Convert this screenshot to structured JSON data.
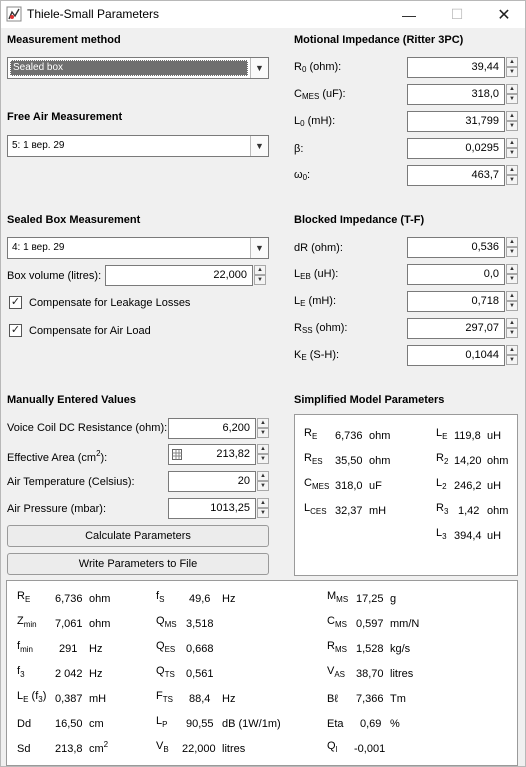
{
  "window": {
    "title": "Thiele-Small Parameters",
    "min_glyph": "—",
    "max_glyph": "☐",
    "close_glyph": "✕"
  },
  "measurement_method": {
    "heading": "Measurement method",
    "selected": "Sealed box"
  },
  "free_air": {
    "heading": "Free Air Measurement",
    "selected": "5: 1 вер. 29"
  },
  "sealed_box": {
    "heading": "Sealed Box Measurement",
    "selected": "4: 1 вер. 29",
    "box_volume_label": "Box volume (litres):",
    "box_volume_value": "22,000",
    "compensate_leakage_label": "Compensate for Leakage Losses",
    "compensate_leakage_checked": true,
    "compensate_air_label": "Compensate for Air Load",
    "compensate_air_checked": true,
    "check_glyph": "✓"
  },
  "manual": {
    "heading": "Manually Entered Values",
    "vc_label": "Voice Coil DC Resistance (ohm):",
    "vc_value": "6,200",
    "area_label_pre": "Effective Area (cm",
    "area_label_sup": "2",
    "area_label_post": "):",
    "area_value": "213,82",
    "temp_label": "Air Temperature (Celsius):",
    "temp_value": "20",
    "pressure_label": "Air Pressure (mbar):",
    "pressure_value": "1013,25",
    "calc_button": "Calculate Parameters",
    "write_button": "Write Parameters to File"
  },
  "motional": {
    "heading": "Motional Impedance (Ritter 3PC)",
    "r0": {
      "main": "R",
      "sub": "0",
      "unit": " (ohm):",
      "value": "39,44"
    },
    "cmes": {
      "main": "C",
      "sub": "MES",
      "unit": " (uF):",
      "value": "318,0"
    },
    "l0": {
      "main": "L",
      "sub": "0",
      "unit": " (mH):",
      "value": "31,799"
    },
    "beta": {
      "main": "β:",
      "value": "0,0295"
    },
    "omega": {
      "main": "ω",
      "sub": "0",
      "unit": ":",
      "value": "463,7"
    }
  },
  "blocked": {
    "heading": "Blocked Impedance (T-F)",
    "dr": {
      "main": "dR (ohm):",
      "value": "0,536"
    },
    "leb": {
      "main": "L",
      "sub": "EB",
      "unit": " (uH):",
      "value": "0,0"
    },
    "le": {
      "main": "L",
      "sub": "E",
      "unit": " (mH):",
      "value": "0,718"
    },
    "rss": {
      "main": "R",
      "sub": "SS",
      "unit": " (ohm):",
      "value": "297,07"
    },
    "ke": {
      "main": "K",
      "sub": "E",
      "unit": " (S-H):",
      "value": "0,1044"
    }
  },
  "simplified": {
    "heading": "Simplified Model Parameters",
    "re": {
      "main": "R",
      "sub": "E",
      "value": "6,736",
      "unit": "ohm"
    },
    "res": {
      "main": "R",
      "sub": "ES",
      "value": "35,50",
      "unit": "ohm"
    },
    "cmes": {
      "main": "C",
      "sub": "MES",
      "value": "318,0",
      "unit": "uF"
    },
    "lces": {
      "main": "L",
      "sub": "CES",
      "value": "32,37",
      "unit": "mH"
    },
    "le": {
      "main": "L",
      "sub": "E",
      "value": "119,8",
      "unit": "uH"
    },
    "r2": {
      "main": "R",
      "sub": "2",
      "value": "14,20",
      "unit": "ohm"
    },
    "l2": {
      "main": "L",
      "sub": "2",
      "value": "246,2",
      "unit": "uH"
    },
    "r3": {
      "main": "R",
      "sub": "3",
      "value": "1,42",
      "unit": "ohm"
    },
    "l3": {
      "main": "L",
      "sub": "3",
      "value": "394,4",
      "unit": "uH"
    }
  },
  "results": {
    "re": {
      "main": "R",
      "sub": "E",
      "value": "6,736",
      "unit": "ohm"
    },
    "zmin": {
      "main": "Z",
      "sub": "min",
      "value": "7,061",
      "unit": "ohm"
    },
    "fmin": {
      "main": "f",
      "sub": "min",
      "value": "291",
      "unit": "Hz"
    },
    "f3": {
      "main": "f",
      "sub": "3",
      "value": "2 042",
      "unit": "Hz"
    },
    "le_f3": {
      "main": "L",
      "sub": "E",
      "post": " (f",
      "sub2": "3",
      "post2": ")",
      "value": "0,387",
      "unit": "mH"
    },
    "dd": {
      "main": "Dd",
      "value": "16,50",
      "unit": "cm"
    },
    "sd": {
      "main": "Sd",
      "value": "213,8",
      "unit": "cm",
      "unit_sup": "2"
    },
    "fs": {
      "main": "f",
      "sub": "S",
      "value": "49,6",
      "unit": "Hz"
    },
    "qms": {
      "main": "Q",
      "sub": "MS",
      "value": "3,518",
      "unit": ""
    },
    "qes": {
      "main": "Q",
      "sub": "ES",
      "value": "0,668",
      "unit": ""
    },
    "qts": {
      "main": "Q",
      "sub": "TS",
      "value": "0,561",
      "unit": ""
    },
    "fts": {
      "main": "F",
      "sub": "TS",
      "value": "88,4",
      "unit": "Hz"
    },
    "lp": {
      "main": "L",
      "sub": "P",
      "value": "90,55",
      "unit": "dB (1W/1m)"
    },
    "vb": {
      "main": "V",
      "sub": "B",
      "value": "22,000",
      "unit": "litres"
    },
    "mms": {
      "main": "M",
      "sub": "MS",
      "value": "17,25",
      "unit": "g"
    },
    "cms": {
      "main": "C",
      "sub": "MS",
      "value": "0,597",
      "unit": "mm/N"
    },
    "rms": {
      "main": "R",
      "sub": "MS",
      "value": "1,528",
      "unit": "kg/s"
    },
    "vas": {
      "main": "V",
      "sub": "AS",
      "value": "38,70",
      "unit": "litres"
    },
    "bl": {
      "main": "Bℓ",
      "value": "7,366",
      "unit": "Tm"
    },
    "eta": {
      "main": "Eta",
      "value": "0,69",
      "unit": "%"
    },
    "ql": {
      "main": "Q",
      "sub": "l",
      "value": "-0,001",
      "unit": ""
    }
  }
}
